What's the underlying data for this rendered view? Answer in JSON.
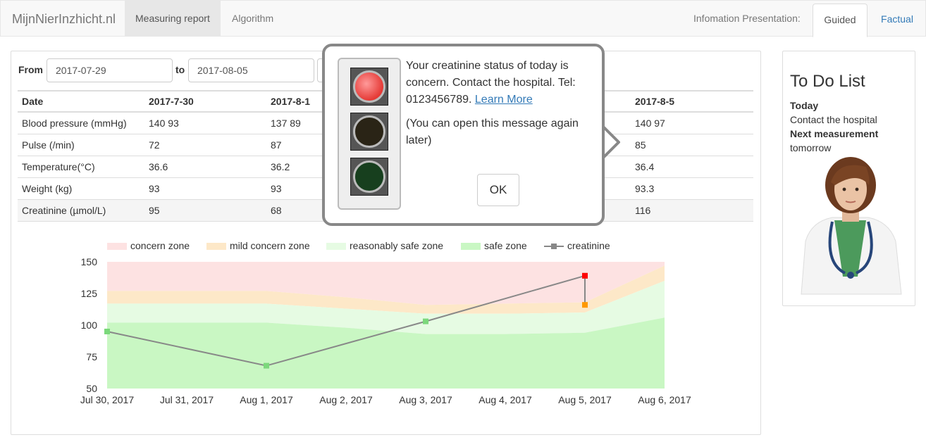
{
  "navbar": {
    "brand": "MijnNierInzhicht.nl",
    "items": [
      "Measuring report",
      "Algorithm"
    ],
    "presentation_label": "Infomation Presentation:",
    "tabs": [
      "Guided",
      "Factual"
    ]
  },
  "filter": {
    "from_label": "From",
    "from_value": "2017-07-29",
    "to_label": "to",
    "to_value": "2017-08-05"
  },
  "table": {
    "headers": [
      "Date",
      "2017-7-30",
      "2017-8-1",
      "2017-8-5"
    ],
    "rows": [
      {
        "label": "Blood pressure (mmHg)",
        "v1": "140 93",
        "v2": "137 89",
        "v3": "140 97"
      },
      {
        "label": "Pulse (/min)",
        "v1": "72",
        "v2": "87",
        "v3": "85"
      },
      {
        "label": "Temperature(°C)",
        "v1": "36.6",
        "v2": "36.2",
        "v3": "36.4"
      },
      {
        "label": "Weight (kg)",
        "v1": "93",
        "v2": "93",
        "v3": "93.3"
      },
      {
        "label": "Creatinine (µmol/L)",
        "v1": "95",
        "v2": "68",
        "v3": "116"
      }
    ]
  },
  "popup": {
    "message": "Your creatinine status of today is concern. Contact the hospital. Tel: 0123456789.",
    "link": "Learn More",
    "note": "(You can open this message again later)",
    "ok_label": "OK",
    "lights": [
      "#e53935",
      "#2a2416",
      "#173f1e"
    ]
  },
  "todo": {
    "title": "To Do List",
    "today_label": "Today",
    "today_value": "Contact the hospital",
    "next_label": "Next measurement",
    "next_value": "tomorrow"
  },
  "chart_data": {
    "type": "line",
    "title": "",
    "legend": [
      "concern zone",
      "mild concern zone",
      "reasonably safe zone",
      "safe zone",
      "creatinine"
    ],
    "legend_placement": "top",
    "x": [
      "Jul 30, 2017",
      "Jul 31, 2017",
      "Aug 1, 2017",
      "Aug 2, 2017",
      "Aug 3, 2017",
      "Aug 4, 2017",
      "Aug 5, 2017",
      "Aug 6, 2017"
    ],
    "ylim": [
      50,
      150
    ],
    "yticks": [
      150,
      125,
      100,
      75,
      50
    ],
    "series": [
      {
        "name": "creatinine",
        "x": [
          0,
          2,
          4,
          6
        ],
        "values": [
          95,
          68,
          103,
          139
        ]
      }
    ],
    "zones": {
      "safe_top": [
        102,
        102,
        102,
        98,
        93,
        93,
        94,
        106
      ],
      "reasonably_safe_top": [
        117,
        117,
        117,
        113,
        109,
        109,
        110,
        135
      ],
      "mild_concern_top": [
        127,
        127,
        127,
        122,
        116,
        117,
        118,
        147
      ],
      "concern_top": [
        150,
        150,
        150,
        150,
        150,
        150,
        150,
        150
      ]
    },
    "highlights": [
      {
        "x": 6,
        "value": 139,
        "color": "#ff0000"
      },
      {
        "x": 6,
        "value": 116,
        "color": "#ff9800"
      }
    ],
    "colors": {
      "concern": "#fde2e2",
      "mild_concern": "#fde8c8",
      "reasonably_safe": "#e6fbe3",
      "safe": "#c9f7c3",
      "line": "#888888"
    }
  }
}
